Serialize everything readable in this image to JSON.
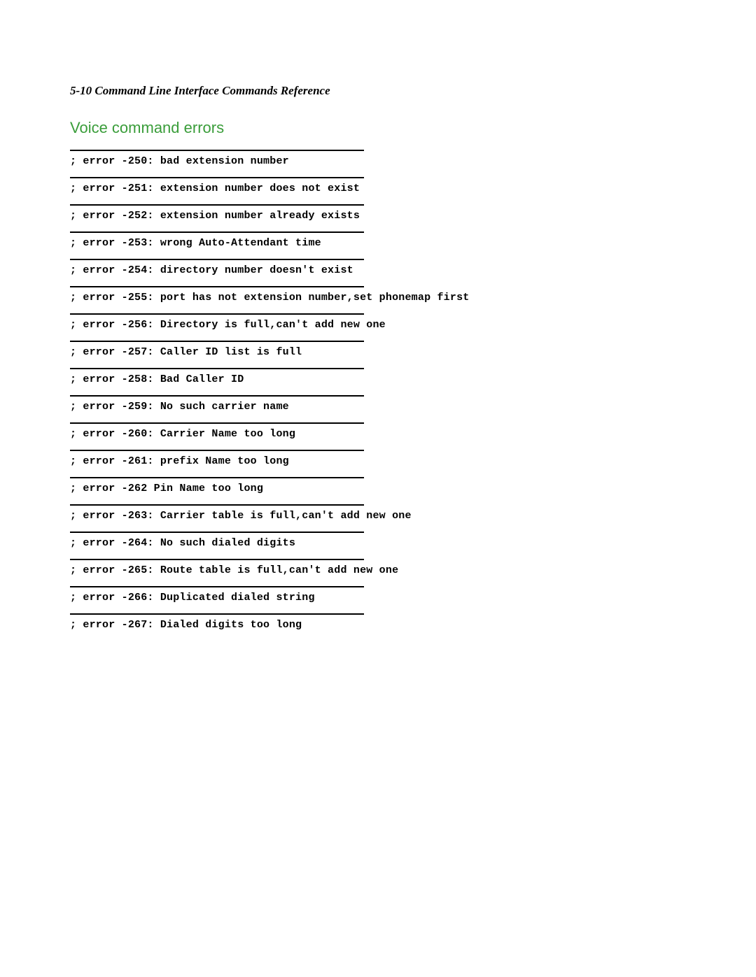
{
  "header": "5-10  Command Line Interface Commands Reference",
  "section_title": "Voice command errors",
  "errors": [
    "; error -250: bad extension number",
    "; error -251: extension number does not exist",
    "; error -252: extension number already exists",
    "; error -253: wrong Auto-Attendant time",
    "; error -254: directory number doesn't exist",
    "; error -255: port has not extension number,set phonemap first",
    "; error -256: Directory is full,can't add new one",
    "; error -257: Caller ID list is full",
    "; error -258: Bad Caller ID",
    "; error -259: No such carrier name",
    "; error -260: Carrier Name too long",
    "; error -261: prefix Name too long",
    "; error -262 Pin Name too long",
    "; error -263: Carrier table is full,can't add new one",
    "; error -264: No such dialed digits",
    "; error -265: Route table is full,can't add new one",
    "; error -266: Duplicated dialed string",
    "; error -267: Dialed digits too long"
  ]
}
